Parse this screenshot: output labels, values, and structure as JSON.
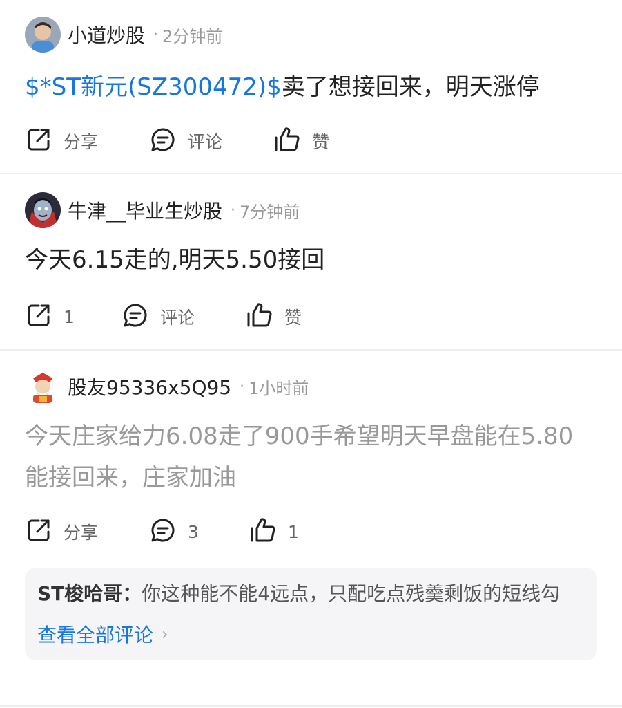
{
  "posts": [
    {
      "username": "小道炒股",
      "time": "2分钟前",
      "content_link": "$*ST新元(SZ300472)$",
      "content": "卖了想接回来，明天涨停",
      "share_label": "分享",
      "comment_label": "评论",
      "like_label": "赞"
    },
    {
      "username": "牛津__毕业生炒股",
      "time": "7分钟前",
      "content": "今天6.15走的,明天5.50接回",
      "share_label": "1",
      "comment_label": "评论",
      "like_label": "赞"
    },
    {
      "username": "股友95336x5Q95",
      "time": "1小时前",
      "content": "今天庄家给力6.08走了900手希望明天早盘能在5.80能接回来，庄家加油",
      "share_label": "分享",
      "comment_label": "3",
      "like_label": "1",
      "reply": {
        "author": "ST梭哈哥：",
        "text": "你这种能不能4远点，只配吃点残羹剩饭的短线勾",
        "view_all": "查看全部评论",
        "view_all_chevron": "›"
      }
    }
  ],
  "separator_dot": "·",
  "colors": {
    "link": "#1677e0",
    "muted": "#999999",
    "icon": "#222222"
  },
  "icons": {
    "share": "share-icon",
    "comment": "comment-icon",
    "like": "thumbs-up-icon"
  }
}
